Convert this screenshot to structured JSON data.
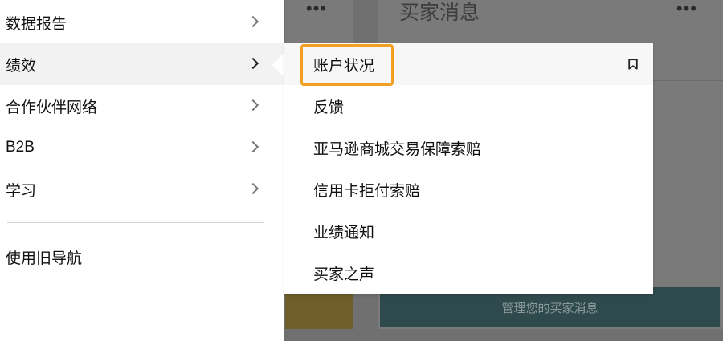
{
  "background": {
    "card_title": "买家消息",
    "more_icon": "more-horizontal-icon",
    "manage_button_label": "管理您的买家消息"
  },
  "nav": {
    "items": [
      {
        "label": "数据报告"
      },
      {
        "label": "绩效",
        "active": true
      },
      {
        "label": "合作伙伴网络"
      },
      {
        "label": "B2B"
      },
      {
        "label": "学习"
      }
    ],
    "legacy_link": "使用旧导航"
  },
  "submenu": {
    "items": [
      {
        "label": "账户状况",
        "highlighted": true
      },
      {
        "label": "反馈"
      },
      {
        "label": "亚马逊商城交易保障索赔"
      },
      {
        "label": "信用卡拒付索赔"
      },
      {
        "label": "业绩通知"
      },
      {
        "label": "买家之声"
      }
    ],
    "pin_icon": "bookmark-icon"
  },
  "colors": {
    "highlight": "#f0a023",
    "manage_button": "#2f4a4c",
    "overlay": "#707070"
  }
}
